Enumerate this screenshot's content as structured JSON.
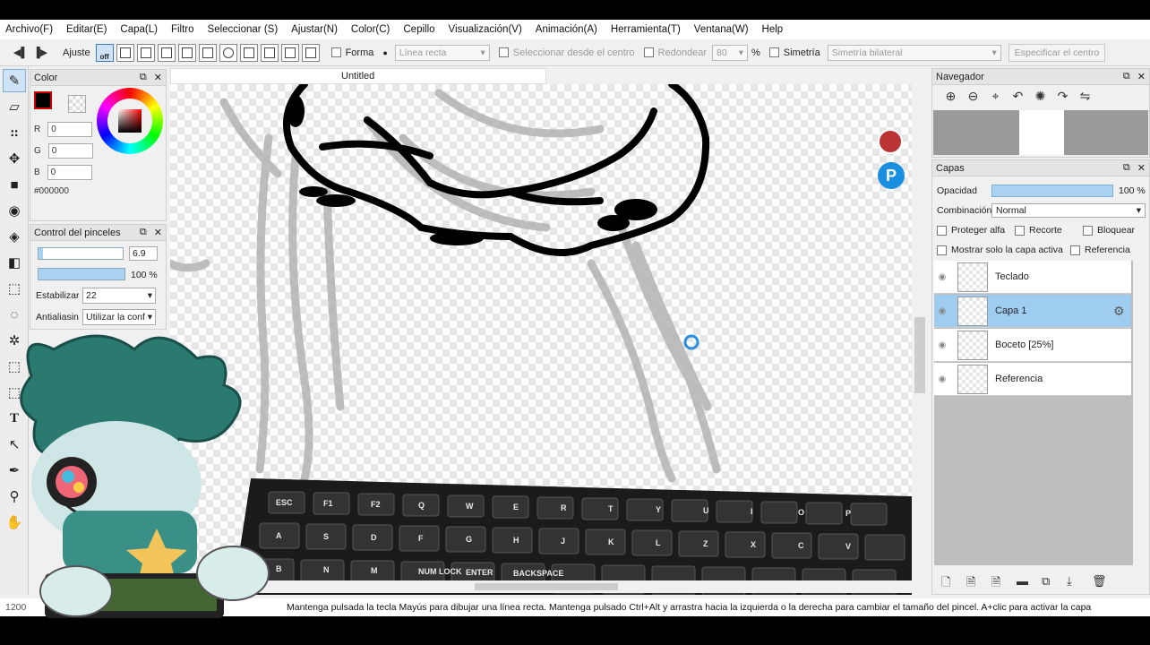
{
  "menu": [
    "Archivo(F)",
    "Editar(E)",
    "Capa(L)",
    "Filtro",
    "Seleccionar (S)",
    "Ajustar(N)",
    "Color(C)",
    "Cepillo",
    "Visualización(V)",
    "Animación(A)",
    "Herramienta(T)",
    "Ventana(W)",
    "Help"
  ],
  "toolbar": {
    "ajuste_label": "Ajuste",
    "off_label": "off",
    "forma_label": "Forma",
    "forma_value": "Línea recta",
    "select_center_label": "Seleccionar desde el centro",
    "redondear_label": "Redondear",
    "redondear_value": "80",
    "percent": "%",
    "simetria_label": "Simetría",
    "simetria_value": "Simetría bilateral",
    "especificar_label": "Especificar el centro"
  },
  "color_panel": {
    "title": "Color",
    "r_label": "R",
    "r_value": "0",
    "g_label": "G",
    "g_value": "0",
    "b_label": "B",
    "b_value": "0",
    "hex": "#000000",
    "fg_color": "#000000"
  },
  "brush_panel": {
    "title": "Control del pinceles",
    "size_value": "6.9",
    "size_fraction": 0.05,
    "opacity_value": "100 %",
    "stabilizer_label": "Estabilizar",
    "stabilizer_value": "22",
    "antialias_label": "Antialiasing",
    "antialias_value": "Utilizar la conf"
  },
  "canvas": {
    "tab_title": "Untitled"
  },
  "navigator": {
    "title": "Navegador"
  },
  "layers_panel": {
    "title": "Capas",
    "opacity_label": "Opacidad",
    "opacity_value": "100 %",
    "blend_label": "Combinación",
    "blend_value": "Normal",
    "protect_alpha": "Proteger alfa",
    "clip": "Recorte",
    "lock": "Bloquear",
    "show_active": "Mostrar solo la capa activa",
    "reference": "Referencia",
    "layers": [
      {
        "name": "Teclado",
        "active": false
      },
      {
        "name": "Capa 1",
        "active": true
      },
      {
        "name": "Boceto [25%]",
        "active": false
      },
      {
        "name": "Referencia",
        "active": false
      }
    ]
  },
  "status": {
    "zoom": "1200",
    "message": "Mantenga pulsada la tecla Mayús para dibujar una línea recta. Mantenga pulsado Ctrl+Alt y arrastra hacia la izquierda o la derecha para cambiar el tamaño del pincel. A+clic para activar la capa"
  },
  "keyboard_keys": [
    "ESC",
    "F1",
    "F2",
    "Q",
    "W",
    "E",
    "R",
    "T",
    "Y",
    "U",
    "I",
    "O",
    "P",
    "A",
    "S",
    "D",
    "F",
    "G",
    "H",
    "J",
    "K",
    "L",
    "Z",
    "X",
    "C",
    "V",
    "B",
    "N",
    "M",
    "NUM LOCK",
    "ENTER",
    "BACKSPACE"
  ],
  "colors": {
    "accent": "#9fcdf0",
    "canvas_check": "#e6e6e6",
    "stroke": "#000000",
    "sketch": "#b3b3b3"
  }
}
